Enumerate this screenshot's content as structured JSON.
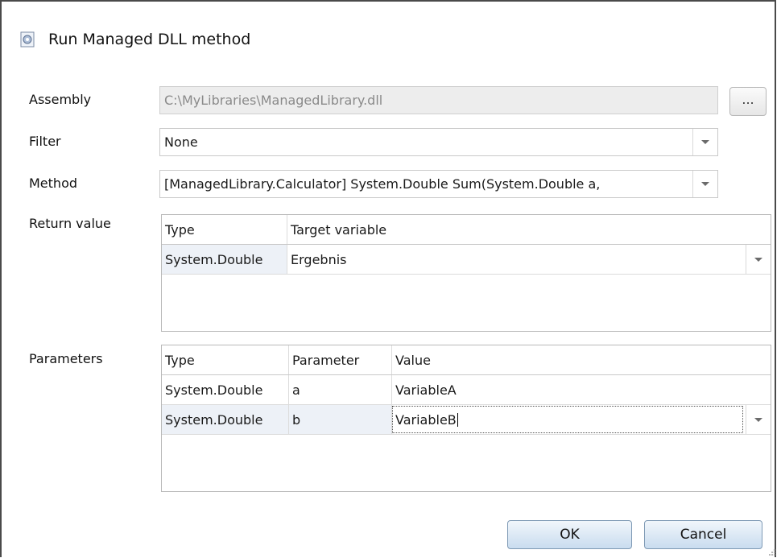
{
  "dialog": {
    "title": "Run Managed DLL method",
    "icon": "dll-method-icon"
  },
  "assembly": {
    "label": "Assembly",
    "value": "C:\\MyLibraries\\ManagedLibrary.dll",
    "browse_label": "..."
  },
  "filter": {
    "label": "Filter",
    "value": "None"
  },
  "method": {
    "label": "Method",
    "value": "[ManagedLibrary.Calculator] System.Double Sum(System.Double a,"
  },
  "return_value": {
    "label": "Return value",
    "columns": [
      "Type",
      "Target variable"
    ],
    "rows": [
      {
        "type": "System.Double",
        "target": "Ergebnis"
      }
    ]
  },
  "parameters": {
    "label": "Parameters",
    "columns": [
      "Type",
      "Parameter",
      "Value"
    ],
    "rows": [
      {
        "type": "System.Double",
        "parameter": "a",
        "value": "VariableA"
      },
      {
        "type": "System.Double",
        "parameter": "b",
        "value": "VariableB"
      }
    ]
  },
  "buttons": {
    "ok": "OK",
    "cancel": "Cancel"
  },
  "colors": {
    "selected_row": "#edf1f7",
    "button_border": "#7f9ab5"
  }
}
